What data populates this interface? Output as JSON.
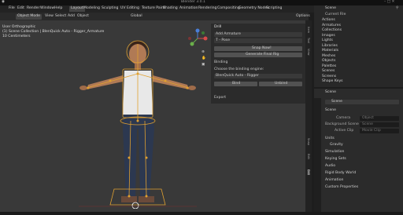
{
  "titlebar": {
    "title": "Blender 3.0.1"
  },
  "menubar": {
    "items": [
      "File",
      "Edit",
      "Render",
      "Window",
      "Help"
    ],
    "workspaces": [
      "Layout",
      "Modeling",
      "Sculpting",
      "UV Editing",
      "Texture Paint",
      "Shading",
      "Animation",
      "Rendering",
      "Compositing",
      "Geometry Nodes",
      "Scripting"
    ],
    "scene": "Scene",
    "view_layer": "ViewLayer"
  },
  "viewport_header": {
    "mode": "Object Mode",
    "menus": [
      "View",
      "Select",
      "Add",
      "Object"
    ],
    "orientation": "Global",
    "options": "Options"
  },
  "viewport": {
    "line1": "User Orthographic",
    "line2": "(1) Scene Collection | BlenQuick Auto - Rigger_Armature",
    "line3": "10 Centimeters"
  },
  "n_panel": {
    "header": "Drill",
    "add_armature": "Add Armature",
    "pose": "T - Pose",
    "snap_button": "Snap Now!",
    "generate_button": "Generate Final Rig",
    "binding_title": "Binding",
    "binding_label": "Choose the binding engine:",
    "binding_engine": "BlenQuick Auto - Rigger",
    "bind": "Bind",
    "unbind": "Unbind",
    "export": "Export",
    "tabs": [
      "Item",
      "Tool",
      "View",
      "Snap",
      "Edit",
      "Drill"
    ]
  },
  "outliner": {
    "header": "Scene",
    "filter": "Current File",
    "items": [
      "Actions",
      "Armatures",
      "Collections",
      "Images",
      "Lights",
      "Libraries",
      "Materials",
      "Meshes",
      "Objects",
      "Palettes",
      "Scenes",
      "Screens",
      "Shape Keys"
    ]
  },
  "properties": {
    "header": "Scene",
    "scene_name": "Scene",
    "section_scene": "Scene",
    "camera_label": "Camera",
    "camera_value": "Object",
    "bg_label": "Background Scene",
    "bg_value": "Scene",
    "clip_label": "Active Clip",
    "clip_value": "Movie Clip",
    "sections": [
      "Units",
      "Gravity",
      "Simulation",
      "Keying Sets",
      "Audio",
      "Rigid Body World",
      "Animation",
      "Custom Properties"
    ]
  },
  "colors": {
    "accent": "#3d5a8a",
    "bone_orange": "#e0a030",
    "viewport_bg": "#393939",
    "skin": "#b07a55",
    "top": "#e8e8e8",
    "jeans": "#2c3850"
  },
  "icons": [
    "blender-logo-icon",
    "search-icon",
    "camera-icon",
    "hand-icon",
    "zoom-icon",
    "filter-icon"
  ]
}
